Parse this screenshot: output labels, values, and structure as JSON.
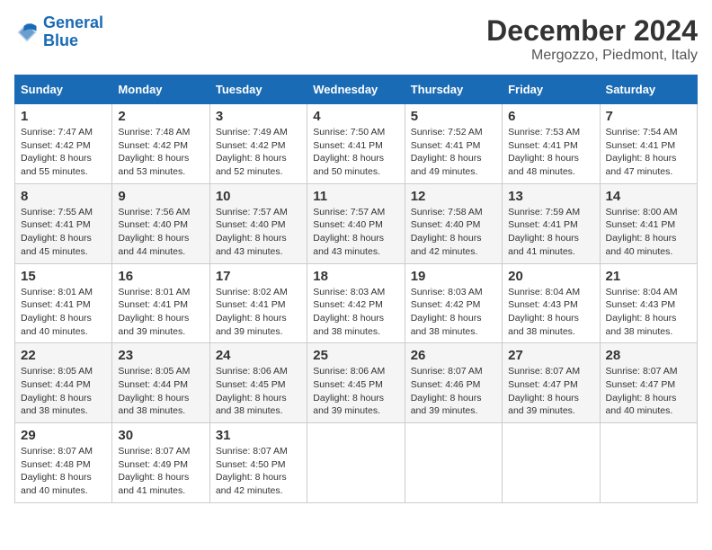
{
  "header": {
    "logo_line1": "General",
    "logo_line2": "Blue",
    "main_title": "December 2024",
    "subtitle": "Mergozzo, Piedmont, Italy"
  },
  "calendar": {
    "days_of_week": [
      "Sunday",
      "Monday",
      "Tuesday",
      "Wednesday",
      "Thursday",
      "Friday",
      "Saturday"
    ],
    "weeks": [
      [
        null,
        null,
        null,
        null,
        null,
        null,
        null
      ]
    ]
  },
  "cells": {
    "w1": {
      "sun": {
        "num": "1",
        "rise": "Sunrise: 7:47 AM",
        "set": "Sunset: 4:42 PM",
        "day": "Daylight: 8 hours and 55 minutes."
      },
      "mon": {
        "num": "2",
        "rise": "Sunrise: 7:48 AM",
        "set": "Sunset: 4:42 PM",
        "day": "Daylight: 8 hours and 53 minutes."
      },
      "tue": {
        "num": "3",
        "rise": "Sunrise: 7:49 AM",
        "set": "Sunset: 4:42 PM",
        "day": "Daylight: 8 hours and 52 minutes."
      },
      "wed": {
        "num": "4",
        "rise": "Sunrise: 7:50 AM",
        "set": "Sunset: 4:41 PM",
        "day": "Daylight: 8 hours and 50 minutes."
      },
      "thu": {
        "num": "5",
        "rise": "Sunrise: 7:52 AM",
        "set": "Sunset: 4:41 PM",
        "day": "Daylight: 8 hours and 49 minutes."
      },
      "fri": {
        "num": "6",
        "rise": "Sunrise: 7:53 AM",
        "set": "Sunset: 4:41 PM",
        "day": "Daylight: 8 hours and 48 minutes."
      },
      "sat": {
        "num": "7",
        "rise": "Sunrise: 7:54 AM",
        "set": "Sunset: 4:41 PM",
        "day": "Daylight: 8 hours and 47 minutes."
      }
    },
    "w2": {
      "sun": {
        "num": "8",
        "rise": "Sunrise: 7:55 AM",
        "set": "Sunset: 4:41 PM",
        "day": "Daylight: 8 hours and 45 minutes."
      },
      "mon": {
        "num": "9",
        "rise": "Sunrise: 7:56 AM",
        "set": "Sunset: 4:40 PM",
        "day": "Daylight: 8 hours and 44 minutes."
      },
      "tue": {
        "num": "10",
        "rise": "Sunrise: 7:57 AM",
        "set": "Sunset: 4:40 PM",
        "day": "Daylight: 8 hours and 43 minutes."
      },
      "wed": {
        "num": "11",
        "rise": "Sunrise: 7:57 AM",
        "set": "Sunset: 4:40 PM",
        "day": "Daylight: 8 hours and 43 minutes."
      },
      "thu": {
        "num": "12",
        "rise": "Sunrise: 7:58 AM",
        "set": "Sunset: 4:40 PM",
        "day": "Daylight: 8 hours and 42 minutes."
      },
      "fri": {
        "num": "13",
        "rise": "Sunrise: 7:59 AM",
        "set": "Sunset: 4:41 PM",
        "day": "Daylight: 8 hours and 41 minutes."
      },
      "sat": {
        "num": "14",
        "rise": "Sunrise: 8:00 AM",
        "set": "Sunset: 4:41 PM",
        "day": "Daylight: 8 hours and 40 minutes."
      }
    },
    "w3": {
      "sun": {
        "num": "15",
        "rise": "Sunrise: 8:01 AM",
        "set": "Sunset: 4:41 PM",
        "day": "Daylight: 8 hours and 40 minutes."
      },
      "mon": {
        "num": "16",
        "rise": "Sunrise: 8:01 AM",
        "set": "Sunset: 4:41 PM",
        "day": "Daylight: 8 hours and 39 minutes."
      },
      "tue": {
        "num": "17",
        "rise": "Sunrise: 8:02 AM",
        "set": "Sunset: 4:41 PM",
        "day": "Daylight: 8 hours and 39 minutes."
      },
      "wed": {
        "num": "18",
        "rise": "Sunrise: 8:03 AM",
        "set": "Sunset: 4:42 PM",
        "day": "Daylight: 8 hours and 38 minutes."
      },
      "thu": {
        "num": "19",
        "rise": "Sunrise: 8:03 AM",
        "set": "Sunset: 4:42 PM",
        "day": "Daylight: 8 hours and 38 minutes."
      },
      "fri": {
        "num": "20",
        "rise": "Sunrise: 8:04 AM",
        "set": "Sunset: 4:43 PM",
        "day": "Daylight: 8 hours and 38 minutes."
      },
      "sat": {
        "num": "21",
        "rise": "Sunrise: 8:04 AM",
        "set": "Sunset: 4:43 PM",
        "day": "Daylight: 8 hours and 38 minutes."
      }
    },
    "w4": {
      "sun": {
        "num": "22",
        "rise": "Sunrise: 8:05 AM",
        "set": "Sunset: 4:44 PM",
        "day": "Daylight: 8 hours and 38 minutes."
      },
      "mon": {
        "num": "23",
        "rise": "Sunrise: 8:05 AM",
        "set": "Sunset: 4:44 PM",
        "day": "Daylight: 8 hours and 38 minutes."
      },
      "tue": {
        "num": "24",
        "rise": "Sunrise: 8:06 AM",
        "set": "Sunset: 4:45 PM",
        "day": "Daylight: 8 hours and 38 minutes."
      },
      "wed": {
        "num": "25",
        "rise": "Sunrise: 8:06 AM",
        "set": "Sunset: 4:45 PM",
        "day": "Daylight: 8 hours and 39 minutes."
      },
      "thu": {
        "num": "26",
        "rise": "Sunrise: 8:07 AM",
        "set": "Sunset: 4:46 PM",
        "day": "Daylight: 8 hours and 39 minutes."
      },
      "fri": {
        "num": "27",
        "rise": "Sunrise: 8:07 AM",
        "set": "Sunset: 4:47 PM",
        "day": "Daylight: 8 hours and 39 minutes."
      },
      "sat": {
        "num": "28",
        "rise": "Sunrise: 8:07 AM",
        "set": "Sunset: 4:47 PM",
        "day": "Daylight: 8 hours and 40 minutes."
      }
    },
    "w5": {
      "sun": {
        "num": "29",
        "rise": "Sunrise: 8:07 AM",
        "set": "Sunset: 4:48 PM",
        "day": "Daylight: 8 hours and 40 minutes."
      },
      "mon": {
        "num": "30",
        "rise": "Sunrise: 8:07 AM",
        "set": "Sunset: 4:49 PM",
        "day": "Daylight: 8 hours and 41 minutes."
      },
      "tue": {
        "num": "31",
        "rise": "Sunrise: 8:07 AM",
        "set": "Sunset: 4:50 PM",
        "day": "Daylight: 8 hours and 42 minutes."
      }
    }
  },
  "colors": {
    "header_bg": "#1a6bb5",
    "header_text": "#ffffff",
    "alt_row": "#f5f5f5"
  }
}
